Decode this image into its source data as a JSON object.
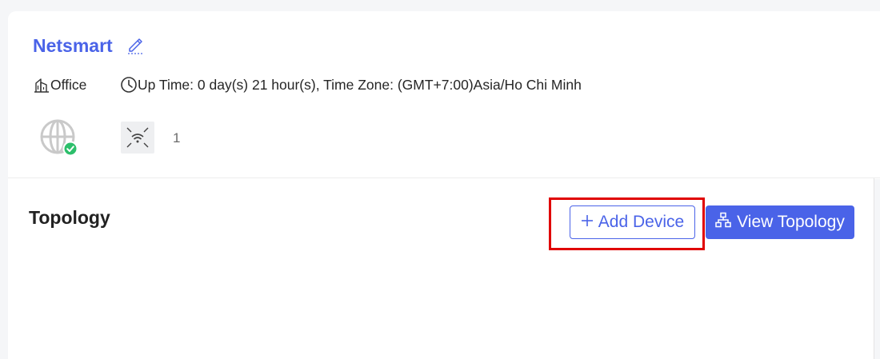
{
  "site": {
    "name": "Netsmart",
    "location": "Office",
    "uptime": "Up Time: 0 day(s) 21 hour(s), Time Zone: (GMT+7:00)Asia/Ho Chi Minh",
    "internet_status": "online",
    "ap_count": "1"
  },
  "topology": {
    "title": "Topology",
    "add_device_label": "Add Device",
    "view_topology_label": "View Topology"
  },
  "icons": {
    "edit": "edit-icon",
    "location": "building-icon",
    "uptime": "clock-icon",
    "internet": "globe-icon",
    "status": "check-circle-icon",
    "access_point": "wifi-access-point-icon",
    "add": "plus-icon",
    "topology": "network-tree-icon"
  },
  "colors": {
    "accent": "#4a63e8",
    "success": "#2dbf6b",
    "highlight": "#e00000",
    "text": "#262626"
  }
}
